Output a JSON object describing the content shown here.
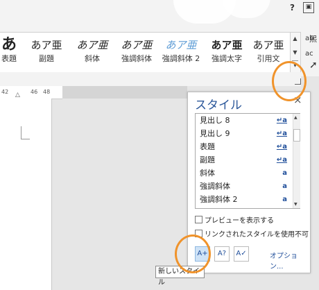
{
  "window": {
    "help_label": "?",
    "restore_label": "▣",
    "right_clip": "熙"
  },
  "gallery": {
    "items": [
      {
        "preview": "あ",
        "label": "表題"
      },
      {
        "preview": "あア亜",
        "label": "副題"
      },
      {
        "preview": "あア亜",
        "label": "斜体"
      },
      {
        "preview": "あア亜",
        "label": "強調斜体"
      },
      {
        "preview": "あア亜",
        "label": "強調斜体 2"
      },
      {
        "preview": "あア亜",
        "label": "強調太字"
      },
      {
        "preview": "あア亜",
        "label": "引用文"
      }
    ],
    "scroll_up": "▲",
    "scroll_down": "▼",
    "more": "▾"
  },
  "side_tools": {
    "abc1": "ab",
    "abc2": "ac"
  },
  "ruler": {
    "ticks": [
      "42",
      "46",
      "48"
    ]
  },
  "styles_pane": {
    "title": "スタイル",
    "close": "×",
    "styles": [
      {
        "name": "見出し 8",
        "icon": "↵a"
      },
      {
        "name": "見出し 9",
        "icon": "↵a"
      },
      {
        "name": "表題",
        "icon": "↵a"
      },
      {
        "name": "副題",
        "icon": "↵a"
      },
      {
        "name": "斜体",
        "icon": "a"
      },
      {
        "name": "強調斜体",
        "icon": "a"
      },
      {
        "name": "強調斜体 2",
        "icon": "a"
      }
    ],
    "preview_checkbox": "プレビューを表示する",
    "linked_checkbox": "リンクされたスタイルを使用不可にす",
    "new_style_icon": "A+",
    "inspector_icon": "A?",
    "manage_icon": "A✓",
    "options_link": "オプション..."
  },
  "tooltip": {
    "text": "新しいスタイル"
  },
  "colors": {
    "accent": "#2b579a",
    "annotation": "#f0932b"
  }
}
